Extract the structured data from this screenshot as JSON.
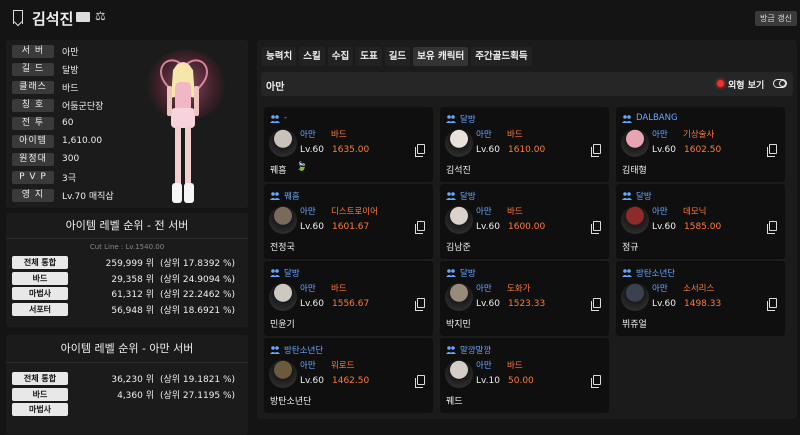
{
  "header": {
    "character_name": "김석진",
    "refresh_label": "방금 갱신"
  },
  "profile": {
    "rows": [
      {
        "label": "서 버",
        "value": "아만"
      },
      {
        "label": "길 드",
        "value": "달방"
      },
      {
        "label": "클래스",
        "value": "바드"
      },
      {
        "label": "칭 호",
        "value": "어둠군단장"
      },
      {
        "label": "전 투",
        "value": "60"
      },
      {
        "label": "아이템",
        "value": "1,610.00"
      },
      {
        "label": "원정대",
        "value": "300"
      },
      {
        "label": "P V P",
        "value": "3극"
      },
      {
        "label": "영 지",
        "value": "Lv.70 매직삽"
      }
    ]
  },
  "ranking_all": {
    "title": "아이템 레벨 순위 - 전 서버",
    "cutline": "Cut Line : Lv.1540.00",
    "rows": [
      {
        "label": "전체 통합",
        "value": "259,999 위",
        "pct": "(상위  17.8392 %)"
      },
      {
        "label": "바드",
        "value": "29,358 위",
        "pct": "(상위  24.9094 %)"
      },
      {
        "label": "마법사",
        "value": "61,312 위",
        "pct": "(상위  22.2462 %)"
      },
      {
        "label": "서포터",
        "value": "56,948 위",
        "pct": "(상위  18.6921 %)"
      }
    ]
  },
  "ranking_server": {
    "title": "아이템 레벨 순위 - 아만 서버",
    "rows": [
      {
        "label": "전체 통합",
        "value": "36,230 위",
        "pct": "(상위  19.1821 %)"
      },
      {
        "label": "바드",
        "value": "4,360 위",
        "pct": "(상위  27.1195 %)"
      },
      {
        "label": "마법사",
        "value": "",
        "pct": ""
      }
    ]
  },
  "tabs": [
    "능력치",
    "스킬",
    "수집",
    "도표",
    "길드",
    "보유 캐릭터",
    "주간골드획득"
  ],
  "active_tab": "보유 캐릭터",
  "server_bar": {
    "server_name": "아만",
    "outfit_label": "외형 보기"
  },
  "characters": [
    {
      "guild": "-",
      "server": "아만",
      "cls": "바드",
      "lv": "Lv.60",
      "ilvl": "1635.00",
      "name": "꿰흠",
      "leaf": "🍃",
      "avatar": "#c9c2b8"
    },
    {
      "guild": "달방",
      "server": "아만",
      "cls": "바드",
      "lv": "Lv.60",
      "ilvl": "1610.00",
      "name": "김석진",
      "leaf": "",
      "avatar": "#e7e2dc"
    },
    {
      "guild": "DALBANG",
      "server": "아만",
      "cls": "기상술사",
      "lv": "Lv.60",
      "ilvl": "1602.50",
      "name": "김태형",
      "leaf": "",
      "avatar": "#e9a3b3"
    },
    {
      "guild": "꿰흠",
      "server": "아만",
      "cls": "디스트로이어",
      "lv": "Lv.60",
      "ilvl": "1601.67",
      "name": "전정국",
      "leaf": "",
      "avatar": "#7a6a5c"
    },
    {
      "guild": "달방",
      "server": "아만",
      "cls": "바드",
      "lv": "Lv.60",
      "ilvl": "1600.00",
      "name": "김남준",
      "leaf": "",
      "avatar": "#d9d3cc"
    },
    {
      "guild": "달방",
      "server": "아만",
      "cls": "데모닉",
      "lv": "Lv.60",
      "ilvl": "1585.00",
      "name": "정규",
      "leaf": "",
      "avatar": "#8e2a2a"
    },
    {
      "guild": "달방",
      "server": "아만",
      "cls": "바드",
      "lv": "Lv.60",
      "ilvl": "1556.67",
      "name": "민윤기",
      "leaf": "",
      "avatar": "#cfc8c0"
    },
    {
      "guild": "달방",
      "server": "아만",
      "cls": "도화가",
      "lv": "Lv.60",
      "ilvl": "1523.33",
      "name": "박지민",
      "leaf": "",
      "avatar": "#9a8a7a"
    },
    {
      "guild": "방탄소년단",
      "server": "아만",
      "cls": "소서리스",
      "lv": "Lv.60",
      "ilvl": "1498.33",
      "name": "뷔쥬얼",
      "leaf": "",
      "avatar": "#3c4150"
    },
    {
      "guild": "방탄소년단",
      "server": "아만",
      "cls": "워로드",
      "lv": "Lv.60",
      "ilvl": "1462.50",
      "name": "방탄소년단",
      "leaf": "",
      "avatar": "#6b5a3e"
    },
    {
      "guild": "말깡말깡",
      "server": "아만",
      "cls": "바드",
      "lv": "Lv.10",
      "ilvl": "50.00",
      "name": "꿰드",
      "leaf": "",
      "avatar": "#d4cec6"
    }
  ]
}
